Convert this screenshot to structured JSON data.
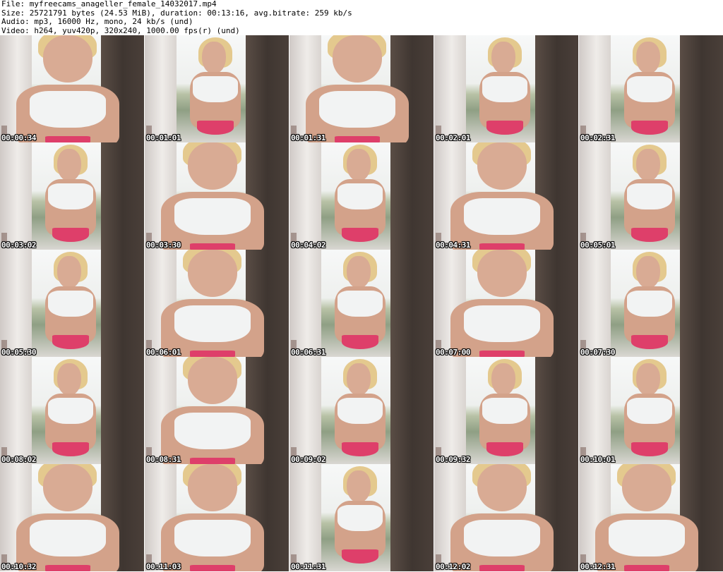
{
  "header": {
    "file": "File: myfreecams_anageller_female_14032017.mp4",
    "size": "Size: 25721791 bytes (24.53 MiB), duration: 00:13:16, avg.bitrate: 259 kb/s",
    "audio": "Audio: mp3, 16000 Hz, mono, 24 kb/s (und)",
    "video": "Video: h264, yuv420p, 320x240, 1000.00 fps(r) (und)"
  },
  "thumbnails": [
    {
      "timestamp": "00:00:34"
    },
    {
      "timestamp": "00:01:01"
    },
    {
      "timestamp": "00:01:31"
    },
    {
      "timestamp": "00:02:01"
    },
    {
      "timestamp": "00:02:31"
    },
    {
      "timestamp": "00:03:02"
    },
    {
      "timestamp": "00:03:30"
    },
    {
      "timestamp": "00:04:02"
    },
    {
      "timestamp": "00:04:31"
    },
    {
      "timestamp": "00:05:01"
    },
    {
      "timestamp": "00:05:30"
    },
    {
      "timestamp": "00:06:01"
    },
    {
      "timestamp": "00:06:31"
    },
    {
      "timestamp": "00:07:00"
    },
    {
      "timestamp": "00:07:30"
    },
    {
      "timestamp": "00:08:02"
    },
    {
      "timestamp": "00:08:31"
    },
    {
      "timestamp": "00:09:02"
    },
    {
      "timestamp": "00:09:32"
    },
    {
      "timestamp": "00:10:01"
    },
    {
      "timestamp": "00:10:32"
    },
    {
      "timestamp": "00:11:03"
    },
    {
      "timestamp": "00:11:31"
    },
    {
      "timestamp": "00:12:02"
    },
    {
      "timestamp": "00:12:31"
    }
  ]
}
